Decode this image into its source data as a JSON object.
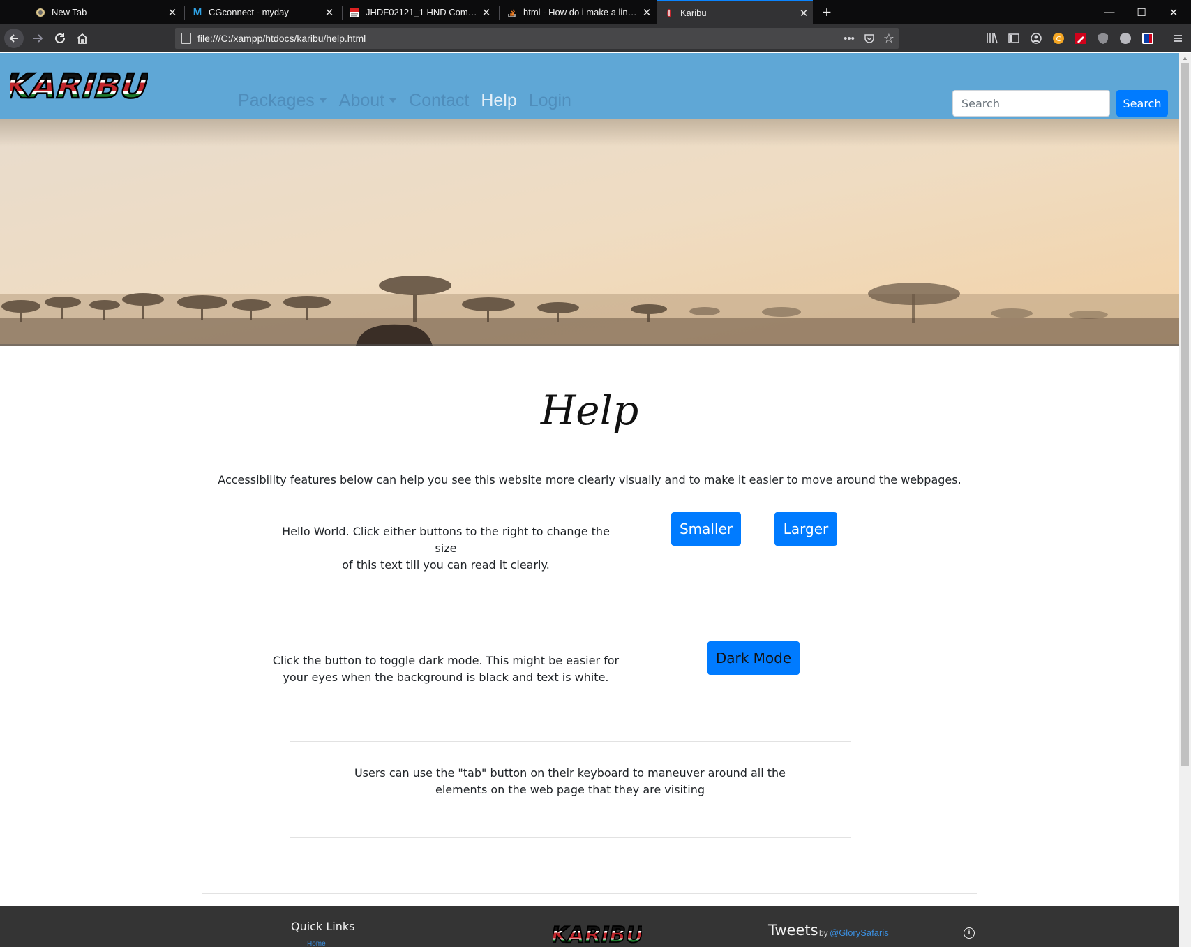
{
  "browser": {
    "tabs": [
      {
        "title": "New Tab",
        "icon": "new-tab-icon"
      },
      {
        "title": "CGconnect - myday",
        "icon": "cgconnect-icon"
      },
      {
        "title": "JHDF02121_1 HND Computing",
        "icon": "pdf-icon"
      },
      {
        "title": "html - How do i make a link wh",
        "icon": "stackoverflow-icon"
      },
      {
        "title": "Karibu",
        "icon": "karibu-icon",
        "active": true
      }
    ],
    "url": "file:///C:/xampp/htdocs/karibu/help.html",
    "accent": "#0a84ff"
  },
  "site": {
    "brand_color": "#5fa7d6",
    "button_color": "#007bff",
    "nav": {
      "packages": "Packages",
      "about": "About",
      "contact": "Contact",
      "help": "Help",
      "login": "Login"
    },
    "search": {
      "placeholder": "Search",
      "button": "Search"
    }
  },
  "content": {
    "title": "Help",
    "lead": "Accessibility features below can help you see this website more clearly visually and to make it easier to move around the webpages.",
    "size_text_line1": "Hello World. Click either buttons to the right to change the size",
    "size_text_line2": "of this text till you can read it clearly.",
    "smaller": "Smaller",
    "larger": "Larger",
    "dark_text_line1": "Click the button to toggle dark mode. This might be easier for",
    "dark_text_line2": "your eyes when the background is black and text is white.",
    "dark_mode": "Dark Mode",
    "tab_text_line1": "Users can use the \"tab\" button on their keyboard to maneuver around all the",
    "tab_text_line2": "elements on the web page that they are visiting"
  },
  "footer": {
    "quick_links": "Quick Links",
    "home": "Home",
    "tweets": "Tweets",
    "by": "by",
    "handle": "@GlorySafaris"
  }
}
